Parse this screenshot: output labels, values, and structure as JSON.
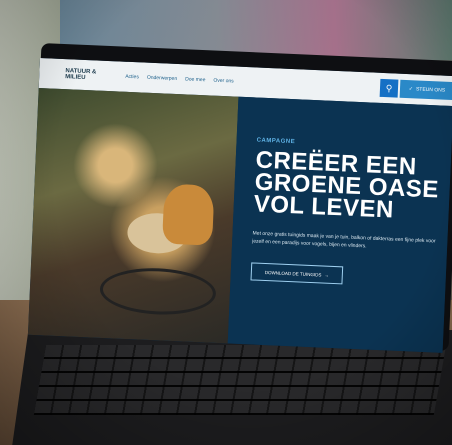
{
  "site": {
    "logo_text": "NATUUR & MILIEU",
    "menu": [
      "Acties",
      "Onderwerpen",
      "Doe mee",
      "Over ons"
    ],
    "cta_label": "STEUN ONS",
    "search_icon": "search-icon",
    "check_icon": "check-icon"
  },
  "hero": {
    "eyebrow": "CAMPAGNE",
    "headline": "CREËER EEN GROENE OASE VOL LEVEN",
    "body": "Met onze gratis tuingids maak je van je tuin, balkon of dakterras een fijne plek voor jezelf en een paradijs voor vogels, bijen en vlinders.",
    "button_label": "DOWNLOAD DE TUINGIDS",
    "button_arrow": "→"
  },
  "colors": {
    "nav_bg": "#eef2f4",
    "panel_bg": "#0b3352",
    "accent": "#2a89c8",
    "eyebrow": "#5fb3e6"
  }
}
